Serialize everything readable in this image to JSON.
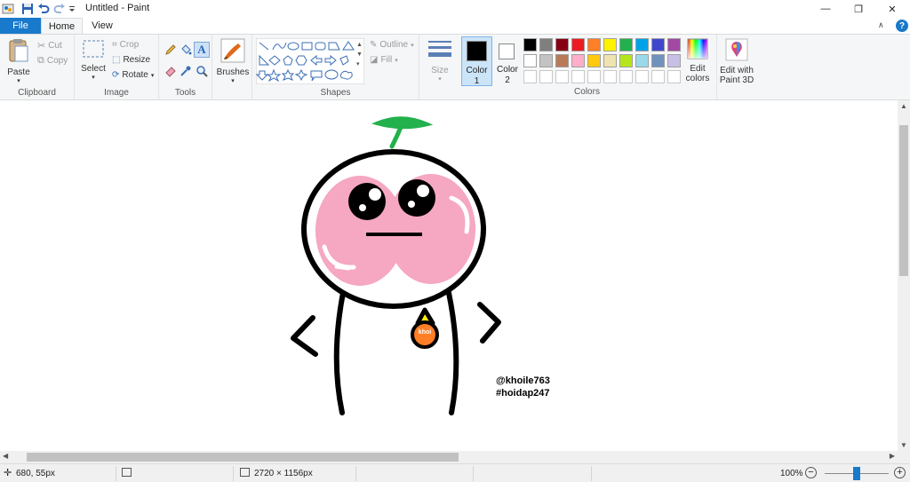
{
  "window": {
    "title": "Untitled - Paint",
    "minimize": "—",
    "restore": "❐",
    "close": "✕"
  },
  "tabs": {
    "file": "File",
    "home": "Home",
    "view": "View"
  },
  "ribbon": {
    "clipboard": {
      "label": "Clipboard",
      "paste": "Paste",
      "cut": "Cut",
      "copy": "Copy"
    },
    "image": {
      "label": "Image",
      "select": "Select",
      "crop": "Crop",
      "resize": "Resize",
      "rotate": "Rotate"
    },
    "tools": {
      "label": "Tools"
    },
    "brushes": {
      "label": "Brushes"
    },
    "shapes": {
      "label": "Shapes",
      "outline": "Outline",
      "fill": "Fill"
    },
    "size": {
      "label": "Size"
    },
    "colors": {
      "label": "Colors",
      "color1_label": "Color",
      "color1_num": "1",
      "color2_label": "Color",
      "color2_num": "2",
      "color1_value": "#000000",
      "color2_value": "#ffffff",
      "edit_colors_line1": "Edit",
      "edit_colors_line2": "colors",
      "edit_paint3d_line1": "Edit with",
      "edit_paint3d_line2": "Paint 3D",
      "palette_row1": [
        "#000000",
        "#7f7f7f",
        "#880015",
        "#ed1c24",
        "#ff7f27",
        "#fff200",
        "#22b14c",
        "#00a2e8",
        "#3f48cc",
        "#a349a4"
      ],
      "palette_row2": [
        "#ffffff",
        "#c3c3c3",
        "#b97a57",
        "#ffaec9",
        "#ffc90e",
        "#efe4b0",
        "#b5e61d",
        "#99d9ea",
        "#7092be",
        "#c8bfe7"
      ]
    }
  },
  "drawing": {
    "handle_line1": "@khoile763",
    "handle_line2": "#hoidap247",
    "badge_text": "khoi",
    "colors": {
      "outline": "#000000",
      "cheeks": "#f6a7c1",
      "leaf": "#22b14c",
      "badge": "#ff7f27",
      "badge_triangle": "#fff200"
    }
  },
  "statusbar": {
    "cursor_pos": "680, 55px",
    "image_size": "2720 × 1156px",
    "zoom": "100%"
  }
}
